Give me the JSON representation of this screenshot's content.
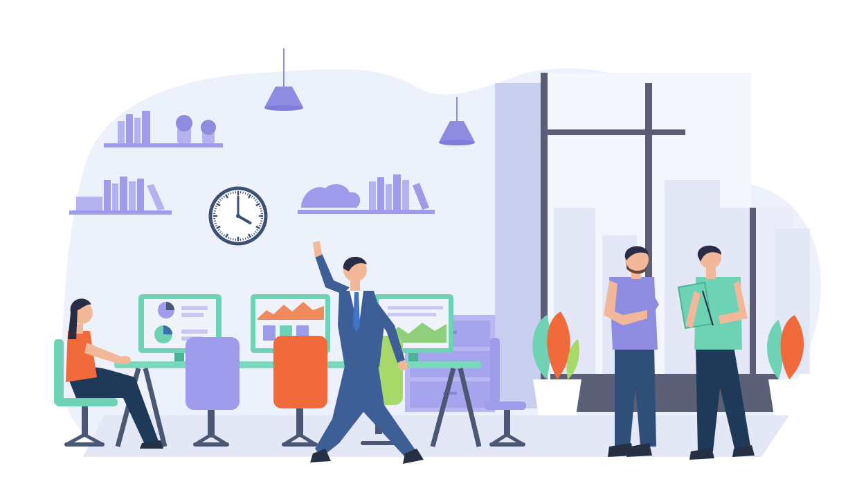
{
  "scene": {
    "subject": "office-illustration",
    "colors": {
      "background": "#ffffff",
      "blob": "#edf1fb",
      "wall_shade": "#e2e7f7",
      "lavender": "#9d9bea",
      "lavender_dark": "#7f7ddc",
      "slate": "#4b5873",
      "teal": "#6ed3b5",
      "teal_dark": "#48b494",
      "orange": "#f06a3b",
      "suit_blue": "#3e5f95",
      "jeans": "#2f4f78",
      "skin": "#f3b79a",
      "hair": "#2a2b45",
      "window_frame": "#5c5d74"
    },
    "clock": {
      "hour": 4,
      "minute": 0
    }
  }
}
